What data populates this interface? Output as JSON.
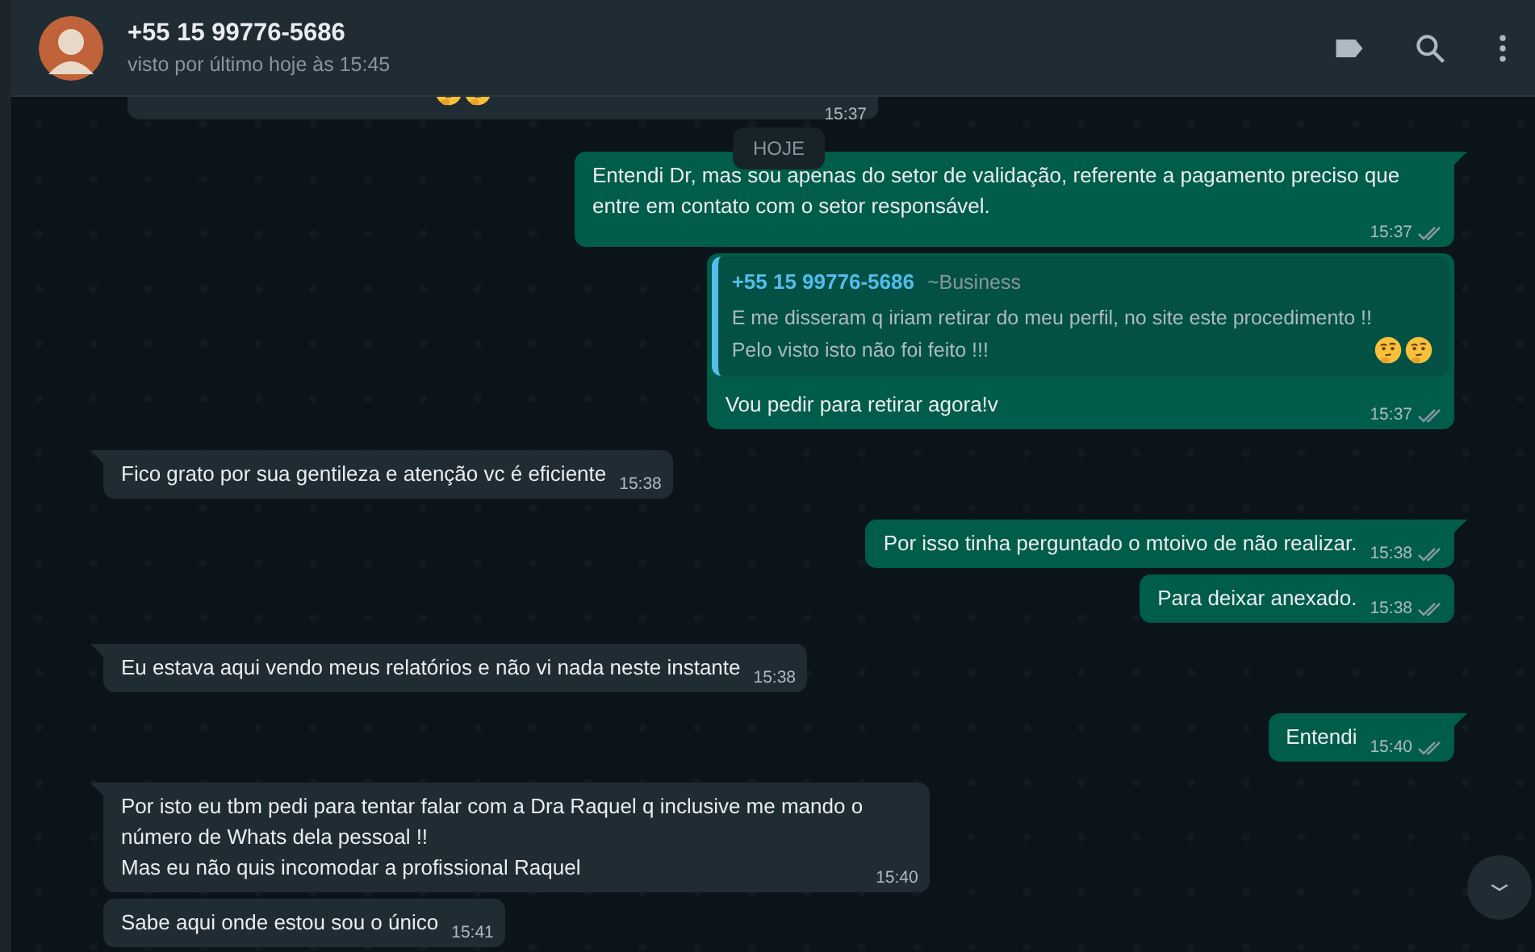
{
  "header": {
    "title": "+55 15 99776-5686",
    "subtitle": "visto por último hoje às 15:45"
  },
  "messages": [
    {
      "kind": "fragment",
      "time": "15:37"
    },
    {
      "kind": "date",
      "text": "HOJE"
    },
    {
      "kind": "outgoing",
      "text": "Entendi Dr, mas sou apenas do setor de validação, referente a pagamento preciso que entre em contato com o setor responsável.",
      "time": "15:37",
      "read": false,
      "tail": true
    },
    {
      "kind": "outgoing",
      "quote": {
        "author": "+55 15 99776-5686",
        "label": "~Business",
        "text": "E me disseram q iriam retirar do meu perfil, no site este procedimento !!\nPelo visto isto não foi feito !!!"
      },
      "text": "Vou pedir para retirar agora!v",
      "time": "15:37",
      "read": false,
      "tail": false
    },
    {
      "kind": "incoming",
      "text": "Fico grato por sua gentileza e atenção vc é eficiente",
      "time": "15:38",
      "tail": true
    },
    {
      "kind": "outgoing",
      "text": "Por isso tinha perguntado o mtoivo de não realizar.",
      "time": "15:38",
      "read": false,
      "tail": true
    },
    {
      "kind": "outgoing",
      "text": "Para deixar anexado.",
      "time": "15:38",
      "read": false,
      "tail": false
    },
    {
      "kind": "incoming",
      "text": "Eu estava aqui vendo meus relatórios e não vi nada neste instante",
      "time": "15:38",
      "tail": true
    },
    {
      "kind": "outgoing",
      "text": "Entendi",
      "time": "15:40",
      "read": false,
      "tail": true
    },
    {
      "kind": "incoming",
      "text": "Por isto eu tbm pedi para tentar falar com a Dra Raquel q inclusive me mando o\nnúmero de Whats dela pessoal !!\nMas eu não quis incomodar a profissional Raquel",
      "time": "15:40",
      "tail": true
    },
    {
      "kind": "incoming",
      "text": "Sabe aqui onde estou sou o único",
      "time": "15:41",
      "tail": false
    }
  ]
}
